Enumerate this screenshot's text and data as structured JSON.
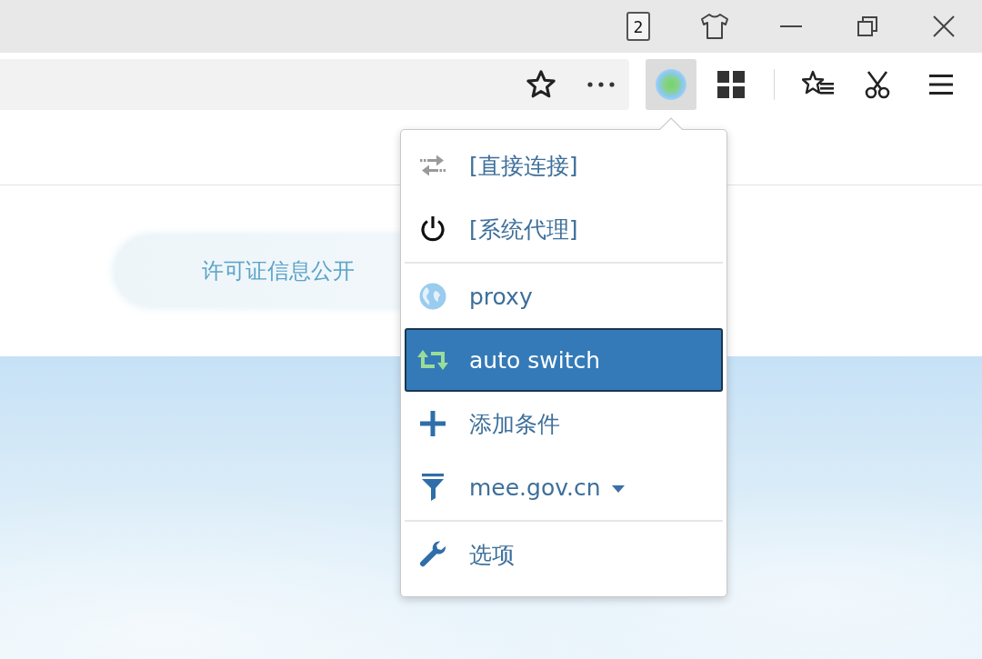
{
  "title_bar": {
    "tab_count": "2"
  },
  "toolbar": {
    "extension_button": {
      "pressed": true
    }
  },
  "page": {
    "notice": "许可证信息公开"
  },
  "proxy_menu": {
    "sections": [
      {
        "items": [
          {
            "kind": "direct",
            "label": "[直接连接]",
            "selected": false
          },
          {
            "kind": "system",
            "label": "[系统代理]",
            "selected": false
          }
        ]
      },
      {
        "items": [
          {
            "kind": "profile",
            "label": "proxy",
            "selected": false,
            "color": "#99ccee"
          },
          {
            "kind": "switch",
            "label": "auto switch",
            "selected": true,
            "color": "#99dd99"
          },
          {
            "kind": "add",
            "label": "添加条件",
            "selected": false
          },
          {
            "kind": "rule",
            "label": "mee.gov.cn",
            "selected": false
          }
        ]
      },
      {
        "items": [
          {
            "kind": "options",
            "label": "选项",
            "selected": false
          }
        ]
      }
    ]
  }
}
